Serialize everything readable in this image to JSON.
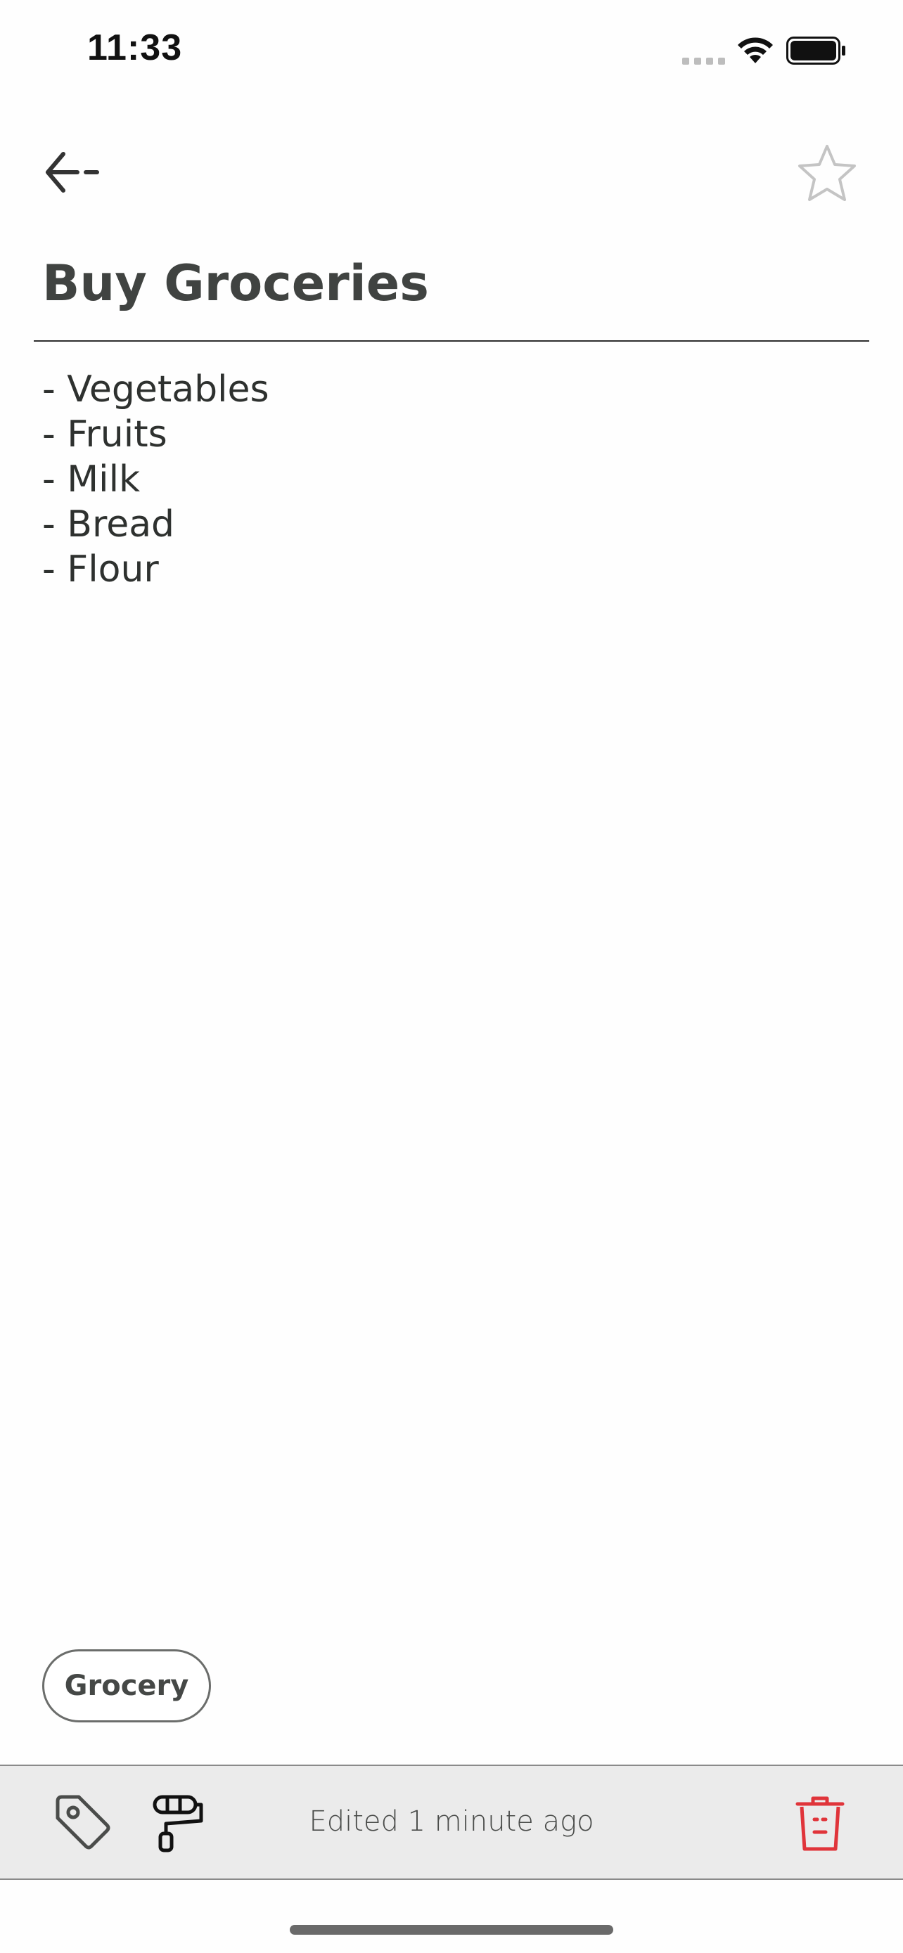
{
  "status_bar": {
    "time": "11:33",
    "icons": [
      "signal-icon",
      "wifi-icon",
      "battery-icon"
    ]
  },
  "header": {
    "back_icon": "arrow-left-icon",
    "favorite_icon": "star-outline-icon"
  },
  "note": {
    "title": "Buy Groceries",
    "lines": [
      "- Vegetables",
      "- Fruits",
      "- Milk",
      "- Bread",
      "- Flour"
    ]
  },
  "tags": [
    {
      "label": "Grocery"
    }
  ],
  "toolbar": {
    "tag_icon": "tag-icon",
    "palette_icon": "paint-roller-icon",
    "edited_label": "Edited 1 minute ago",
    "delete_icon": "trash-icon"
  },
  "colors": {
    "delete_accent": "#e0343a",
    "toolbar_bg": "#ebebeb",
    "text": "#3f4240"
  }
}
